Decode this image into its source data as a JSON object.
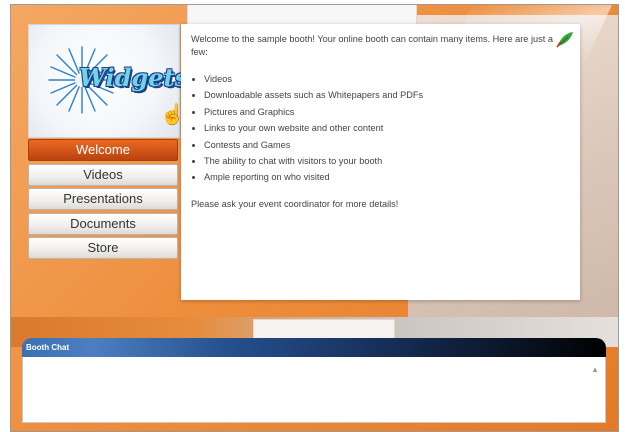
{
  "logo": {
    "text": "Widgets",
    "icon": "starburst-logo"
  },
  "nav": {
    "items": [
      {
        "label": "Welcome",
        "active": true
      },
      {
        "label": "Videos",
        "active": false
      },
      {
        "label": "Presentations",
        "active": false
      },
      {
        "label": "Documents",
        "active": false
      },
      {
        "label": "Store",
        "active": false
      }
    ]
  },
  "content": {
    "intro": "Welcome to the sample booth! Your online booth can contain many items. Here are just a few:",
    "bullets": [
      "Videos",
      "Downloadable assets such as Whitepapers and PDFs",
      "Pictures and Graphics",
      "Links to your own website and other content",
      "Contests and Games",
      "The ability to chat with visitors to your booth",
      "Ample reporting on who visited"
    ],
    "outro": "Please ask your event coordinator for more details!"
  },
  "chat": {
    "title": "Booth Chat"
  },
  "colors": {
    "accent": "#d4561a",
    "background": "#ee8f3e",
    "chat_header_start": "#3a6fb5",
    "chat_header_end": "#000000"
  }
}
